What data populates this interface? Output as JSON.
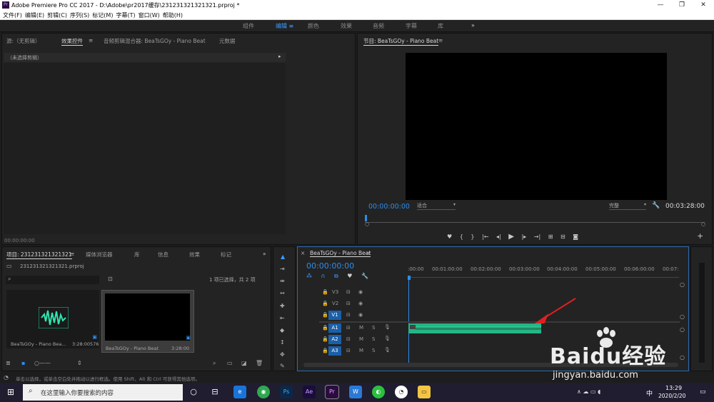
{
  "title_bar": {
    "app_title": "Adobe Premiere Pro CC 2017 - D:\\Adobe\\pr2017缓存\\231231321321321.prproj *",
    "icon": "Pr"
  },
  "menu": [
    "文件(F)",
    "编辑(E)",
    "剪辑(C)",
    "序列(S)",
    "标记(M)",
    "字幕(T)",
    "窗口(W)",
    "帮助(H)"
  ],
  "workspaces": [
    "组件",
    "编辑",
    "颜色",
    "效果",
    "音频",
    "字幕",
    "库"
  ],
  "source_panel": {
    "tabs": [
      "源:（无剪辑）",
      "效果控件",
      "音频剪辑混合器: BeaTsGOy - Piano Beat",
      "元数据"
    ],
    "no_clip": "（未选择剪辑）",
    "timecode": "00:00:00:00"
  },
  "program_panel": {
    "title": "节目: BeaTsGOy - Piano Beat",
    "timecode": "00:00:00:00",
    "fit": "适合",
    "quality": "完整",
    "duration": "00:03:28:00"
  },
  "project_panel": {
    "tabs": [
      "项目: 231231321321321",
      "媒体浏览器",
      "库",
      "信息",
      "效果",
      "标记"
    ],
    "file": "231231321321321.prproj",
    "selection": "1 项已选择，共 2 项",
    "items": [
      {
        "name": "BeaTsGOy - Piano Bea...",
        "duration": "3:28:00576"
      },
      {
        "name": "BeaTsGOy - Piano Beat",
        "duration": "3:28:00"
      }
    ]
  },
  "timeline": {
    "title": "BeaTsGOy - Piano Beat",
    "timecode": "00:00:00:00",
    "ruler": [
      ":00:00",
      "00:01:00:00",
      "00:02:00:00",
      "00:03:00:00",
      "00:04:00:00",
      "00:05:00:00",
      "00:06:00:00",
      "00:07:"
    ],
    "video_tracks": [
      "V3",
      "V2",
      "V1"
    ],
    "audio_tracks": [
      "A1",
      "A2",
      "A3"
    ],
    "m": "M",
    "s": "S"
  },
  "status_bar": "单击以选择，或单击空白处并拖动以进行框选。使用 Shift、Alt 和 Ctrl 可获得其他选项。",
  "taskbar": {
    "search_placeholder": "在这里输入你要搜索的内容",
    "time": "13:29",
    "date": "2020/2/20",
    "ime": "中"
  },
  "watermark": {
    "text": "Baidu经验",
    "url": "jingyan.baidu.com"
  }
}
